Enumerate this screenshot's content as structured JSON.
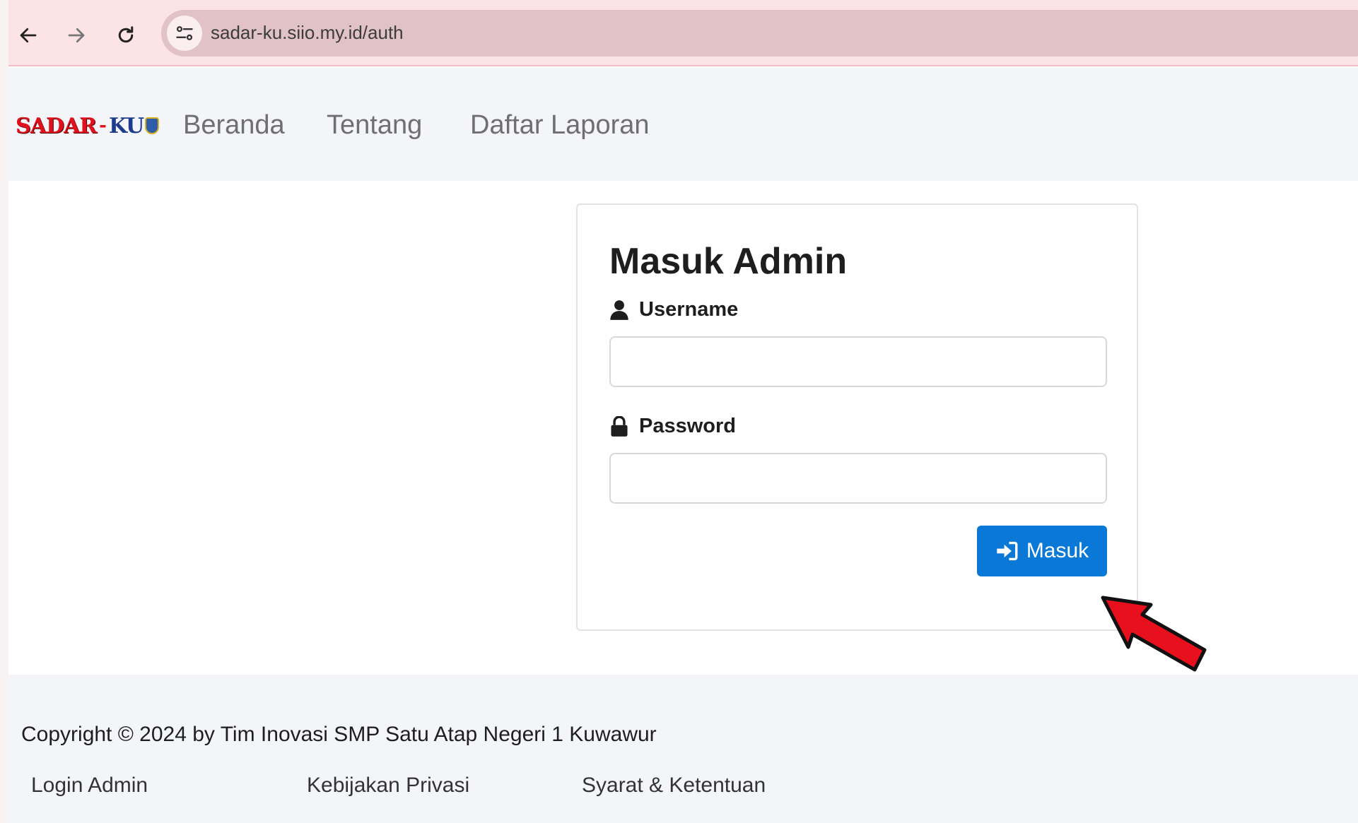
{
  "browser": {
    "url": "sadar-ku.siio.my.id/auth",
    "icons": [
      "back-arrow-icon",
      "forward-arrow-icon",
      "reload-icon",
      "site-settings-icon"
    ]
  },
  "navbar": {
    "logo": {
      "part1": "SADAR",
      "part2": "KU"
    },
    "links": [
      "Beranda",
      "Tentang",
      "Daftar Laporan"
    ]
  },
  "login": {
    "title": "Masuk Admin",
    "username_label": "Username",
    "username_value": "",
    "password_label": "Password",
    "password_value": "",
    "submit_label": "Masuk",
    "button_color": "#0a78d7"
  },
  "footer": {
    "copyright": "Copyright © 2024 by Tim Inovasi SMP Satu Atap Negeri 1 Kuwawur",
    "links": [
      "Login Admin",
      "Kebijakan Privasi",
      "Syarat & Ketentuan"
    ]
  },
  "annotation": {
    "pointer_color": "#e8101c"
  }
}
